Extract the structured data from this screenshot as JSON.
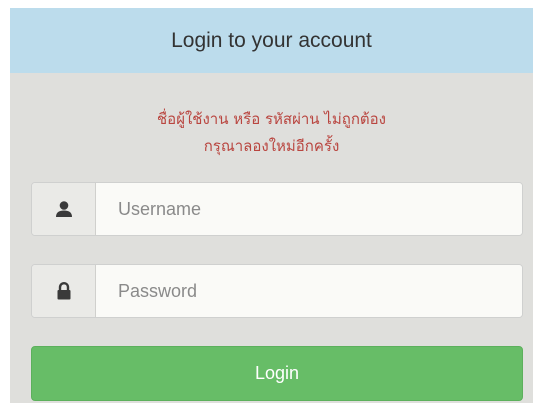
{
  "login_panel": {
    "title": "Login to your account",
    "error_line1": "ชื่อผู้ใช้งาน หรือ รหัสผ่าน ไม่ถูกต้อง",
    "error_line2": "กรุณาลองใหม่อีกครั้ง",
    "username": {
      "icon": "user-icon",
      "placeholder": "Username",
      "value": ""
    },
    "password": {
      "icon": "lock-icon",
      "placeholder": "Password",
      "value": ""
    },
    "login_label": "Login"
  },
  "colors": {
    "header_bg": "#bcdcec",
    "panel_bg": "#dfdfdc",
    "error_text": "#b9453f",
    "button_bg": "#67bd67"
  }
}
